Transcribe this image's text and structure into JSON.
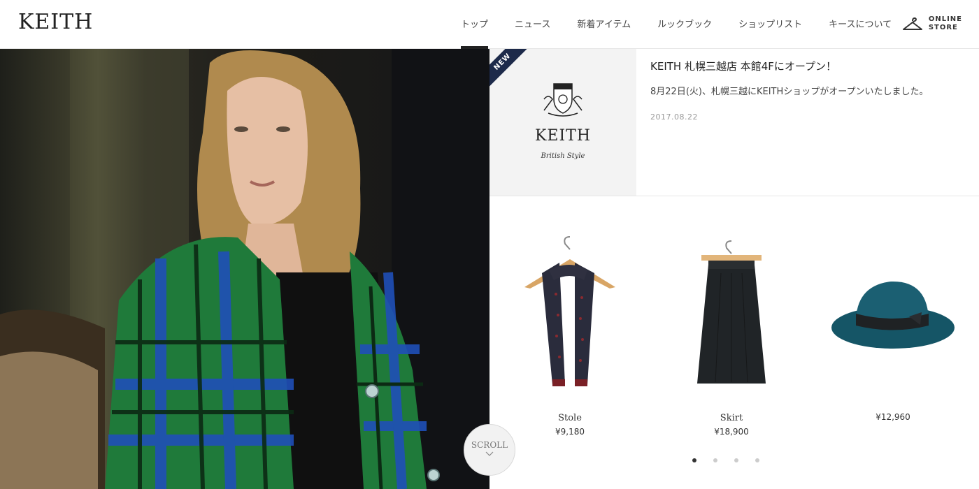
{
  "header": {
    "logo": "KEITH",
    "nav": [
      {
        "label": "トップ",
        "active": true
      },
      {
        "label": "ニュース",
        "active": false
      },
      {
        "label": "新着アイテム",
        "active": false
      },
      {
        "label": "ルックブック",
        "active": false
      },
      {
        "label": "ショップリスト",
        "active": false
      },
      {
        "label": "キースについて",
        "active": false
      }
    ],
    "online_store": {
      "line1": "ONLINE",
      "line2": "STORE",
      "icon": "hanger-icon"
    }
  },
  "hero": {
    "scroll_label": "SCROLL",
    "icon": "chevron-down-icon"
  },
  "news": {
    "badge": "NEW",
    "thumb_logo": "KEITH",
    "thumb_sub": "British Style",
    "title": "KEITH 札幌三越店 本館4Fにオープン！",
    "description": "8月22日(火)、札幌三越にKEITHショップがオープンいたしました。",
    "date": "2017.08.22"
  },
  "products": [
    {
      "name": "Stole",
      "price": "¥9,180"
    },
    {
      "name": "Skirt",
      "price": "¥18,900"
    },
    {
      "name": "",
      "price": "¥12,960"
    }
  ],
  "carousel": {
    "count": 4,
    "active_index": 0
  },
  "colors": {
    "ribbon": "#1d2a4a",
    "plaid_green": "#1f7a3a",
    "plaid_blue": "#1f4fb8",
    "hat": "#1b5f72"
  }
}
